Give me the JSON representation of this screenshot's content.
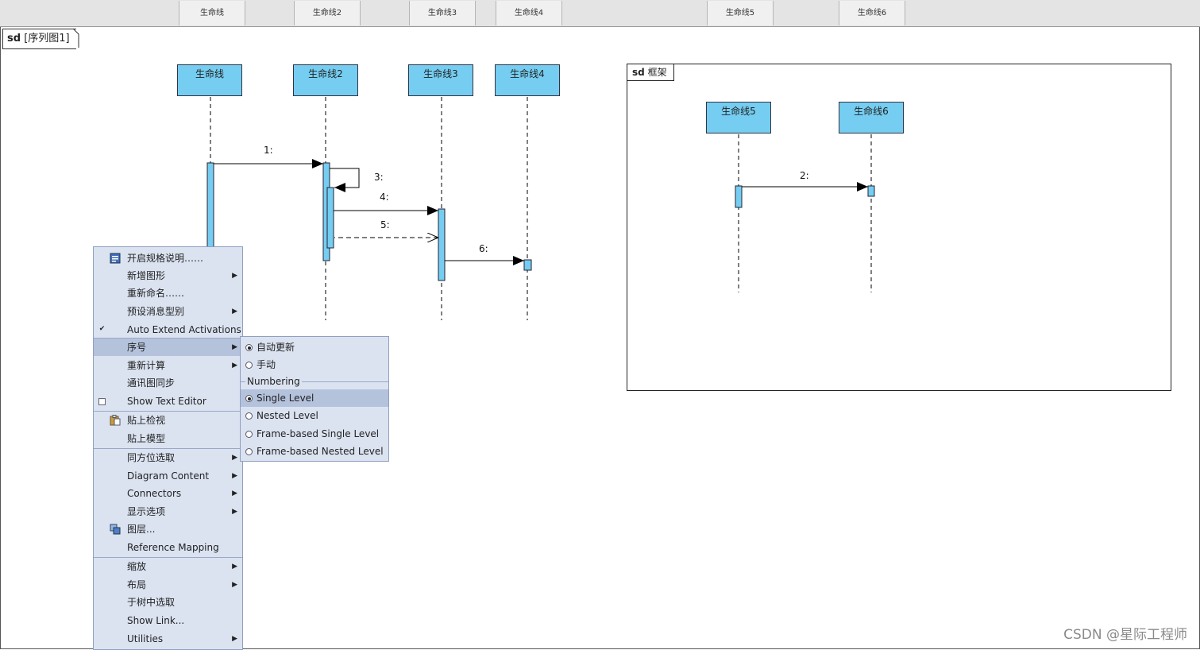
{
  "header": {
    "tabs": [
      "生命线",
      "生命线2",
      "生命线3",
      "生命线4",
      "生命线5",
      "生命线6"
    ]
  },
  "diagram": {
    "tab_keyword": "sd",
    "tab_name": "[序列图1]",
    "lifelines": [
      "生命线",
      "生命线2",
      "生命线3",
      "生命线4",
      "生命线5",
      "生命线6"
    ],
    "messages": [
      "1:",
      "2:",
      "3:",
      "4:",
      "5:",
      "6:"
    ],
    "frame_keyword": "sd",
    "frame_name": "框架"
  },
  "context_menu": {
    "items": [
      {
        "label": "开启规格说明……",
        "icon": "spec-icon"
      },
      {
        "label": "新增图形",
        "arrow": "▶"
      },
      {
        "label": "重新命名……"
      },
      {
        "label": "预设消息型别",
        "arrow": "▶"
      },
      {
        "label": "Auto Extend Activations",
        "check": "✔"
      },
      {
        "label": "序号",
        "arrow": "▶"
      },
      {
        "label": "重新计算",
        "arrow": "▶"
      },
      {
        "label": "通讯图同步"
      },
      {
        "label": "Show Text Editor"
      },
      {
        "label": "贴上检视",
        "icon": "paste-icon"
      },
      {
        "label": "贴上模型"
      },
      {
        "label": "同方位选取",
        "arrow": "▶"
      },
      {
        "label": "Diagram Content",
        "arrow": "▶"
      },
      {
        "label": "Connectors",
        "arrow": "▶"
      },
      {
        "label": "显示选项",
        "arrow": "▶"
      },
      {
        "label": "图层...",
        "icon": "layers-icon"
      },
      {
        "label": "Reference Mapping"
      },
      {
        "label": "缩放",
        "arrow": "▶"
      },
      {
        "label": "布局",
        "arrow": "▶"
      },
      {
        "label": "于树中选取"
      },
      {
        "label": "Show Link..."
      },
      {
        "label": "Utilities",
        "arrow": "▶"
      }
    ]
  },
  "submenu": {
    "auto_update": "自动更新",
    "manual": "手动",
    "section_label": "Numbering",
    "single_level": "Single Level",
    "nested_level": "Nested Level",
    "frame_single": "Frame-based Single Level",
    "frame_nested": "Frame-based Nested Level"
  },
  "colors": {
    "lifeline_fill": "#75cdf1",
    "menu_bg": "#dbe3f1",
    "menu_highlight": "#b4c2dc"
  },
  "watermark": "CSDN @星际工程师"
}
